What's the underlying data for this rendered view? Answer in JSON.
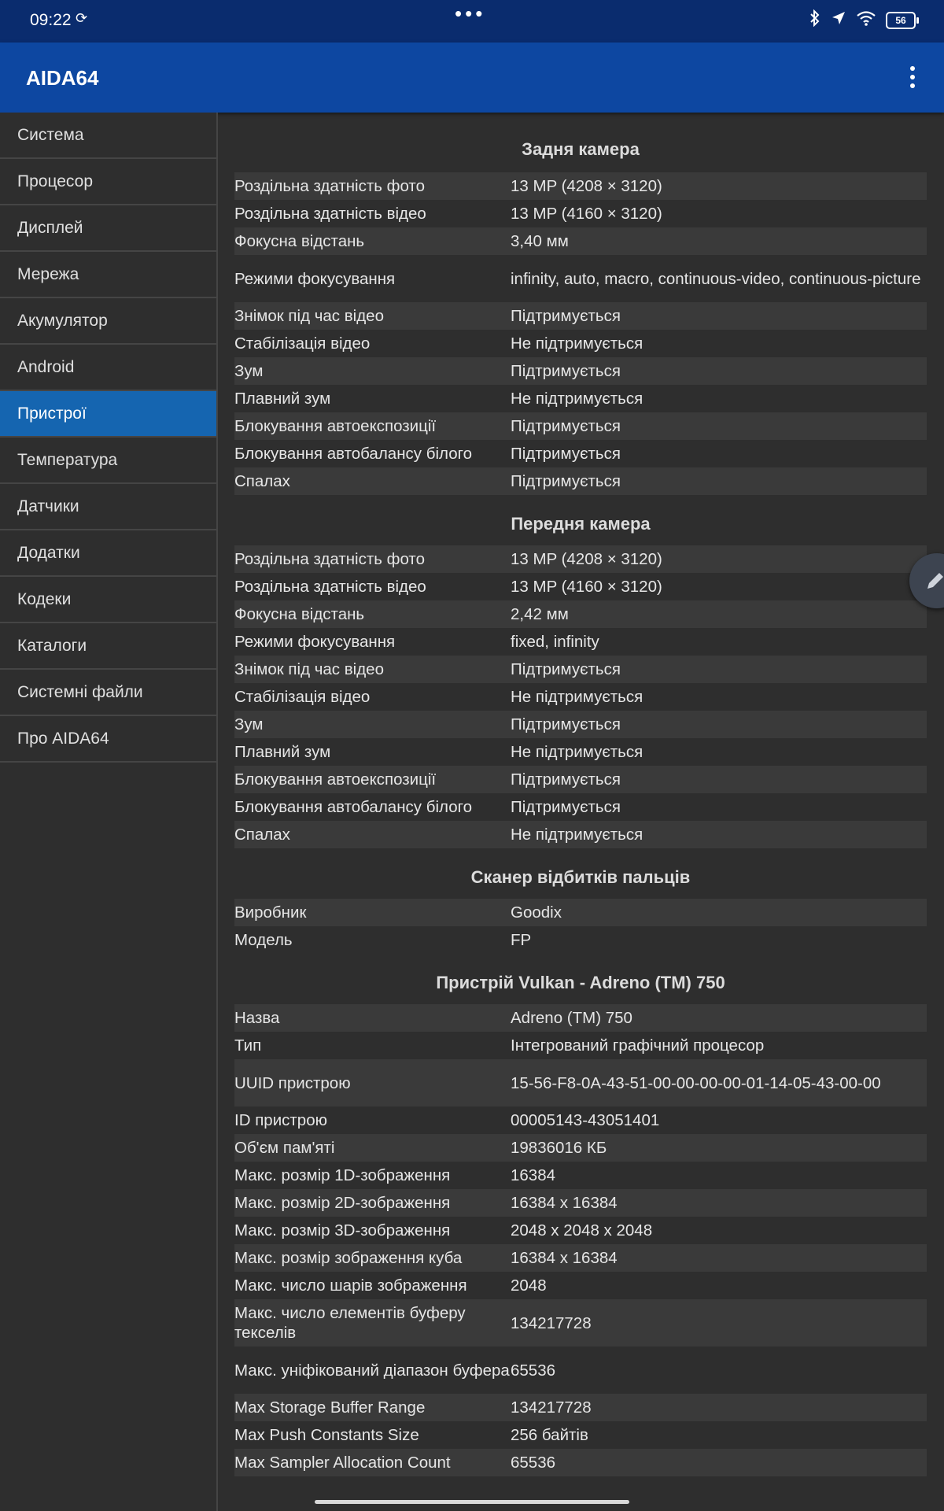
{
  "status": {
    "time": "09:22",
    "battery": "56"
  },
  "appbar": {
    "title": "AIDA64"
  },
  "sidebar": {
    "items": [
      {
        "label": "Система"
      },
      {
        "label": "Процесор"
      },
      {
        "label": "Дисплей"
      },
      {
        "label": "Мережа"
      },
      {
        "label": "Акумулятор"
      },
      {
        "label": "Android"
      },
      {
        "label": "Пристрої",
        "active": true
      },
      {
        "label": "Температура"
      },
      {
        "label": "Датчики"
      },
      {
        "label": "Додатки"
      },
      {
        "label": "Кодеки"
      },
      {
        "label": "Каталоги"
      },
      {
        "label": "Системні файли"
      },
      {
        "label": "Про AIDA64"
      }
    ]
  },
  "sections": [
    {
      "title": "Задня камера",
      "rows": [
        {
          "k": "Роздільна здатність фото",
          "v": "13 MP (4208 × 3120)"
        },
        {
          "k": "Роздільна здатність відео",
          "v": "13 MP (4160 × 3120)"
        },
        {
          "k": "Фокусна відстань",
          "v": "3,40 мм"
        },
        {
          "k": "Режими фокусування",
          "v": "infinity, auto, macro, continuous-video, continuous-picture"
        },
        {
          "k": "Знімок під час відео",
          "v": "Підтримується"
        },
        {
          "k": "Стабілізація відео",
          "v": "Не підтримується"
        },
        {
          "k": "Зум",
          "v": "Підтримується"
        },
        {
          "k": "Плавний зум",
          "v": "Не підтримується"
        },
        {
          "k": "Блокування автоекспозиції",
          "v": "Підтримується"
        },
        {
          "k": "Блокування автобалансу білого",
          "v": "Підтримується"
        },
        {
          "k": "Спалах",
          "v": "Підтримується"
        }
      ]
    },
    {
      "title": "Передня камера",
      "rows": [
        {
          "k": "Роздільна здатність фото",
          "v": "13 MP (4208 × 3120)"
        },
        {
          "k": "Роздільна здатність відео",
          "v": "13 MP (4160 × 3120)"
        },
        {
          "k": "Фокусна відстань",
          "v": "2,42 мм"
        },
        {
          "k": "Режими фокусування",
          "v": "fixed, infinity"
        },
        {
          "k": "Знімок під час відео",
          "v": "Підтримується"
        },
        {
          "k": "Стабілізація відео",
          "v": "Не підтримується"
        },
        {
          "k": "Зум",
          "v": "Підтримується"
        },
        {
          "k": "Плавний зум",
          "v": "Не підтримується"
        },
        {
          "k": "Блокування автоекспозиції",
          "v": "Підтримується"
        },
        {
          "k": "Блокування автобалансу білого",
          "v": "Підтримується"
        },
        {
          "k": "Спалах",
          "v": "Не підтримується"
        }
      ]
    },
    {
      "title": "Сканер відбитків пальців",
      "rows": [
        {
          "k": "Виробник",
          "v": "Goodix"
        },
        {
          "k": "Модель",
          "v": "FP"
        }
      ]
    },
    {
      "title": "Пристрій Vulkan - Adreno (TM) 750",
      "rows": [
        {
          "k": "Назва",
          "v": "Adreno (TM) 750"
        },
        {
          "k": "Тип",
          "v": "Інтегрований графічний процесор"
        },
        {
          "k": "UUID пристрою",
          "v": "15-56-F8-0A-43-51-00-00-00-00-01-14-05-43-00-00"
        },
        {
          "k": "ID пристрою",
          "v": "00005143-43051401"
        },
        {
          "k": "Об'єм пам'яті",
          "v": "19836016 КБ"
        },
        {
          "k": "Макс. розмір 1D-зображення",
          "v": "16384"
        },
        {
          "k": "Макс. розмір 2D-зображення",
          "v": "16384 x 16384"
        },
        {
          "k": "Макс. розмір 3D-зображення",
          "v": "2048 x 2048 x 2048"
        },
        {
          "k": "Макс. розмір зображення куба",
          "v": "16384 x 16384"
        },
        {
          "k": "Макс. число шарів зображення",
          "v": "2048"
        },
        {
          "k": "Макс. число елементів буферу текселів",
          "v": "134217728"
        },
        {
          "k": "Макс. уніфікований діапазон буфера",
          "v": "65536"
        },
        {
          "k": "Max Storage Buffer Range",
          "v": "134217728"
        },
        {
          "k": "Max Push Constants Size",
          "v": "256 байтів"
        },
        {
          "k": "Max Sampler Allocation Count",
          "v": "65536"
        }
      ]
    }
  ]
}
